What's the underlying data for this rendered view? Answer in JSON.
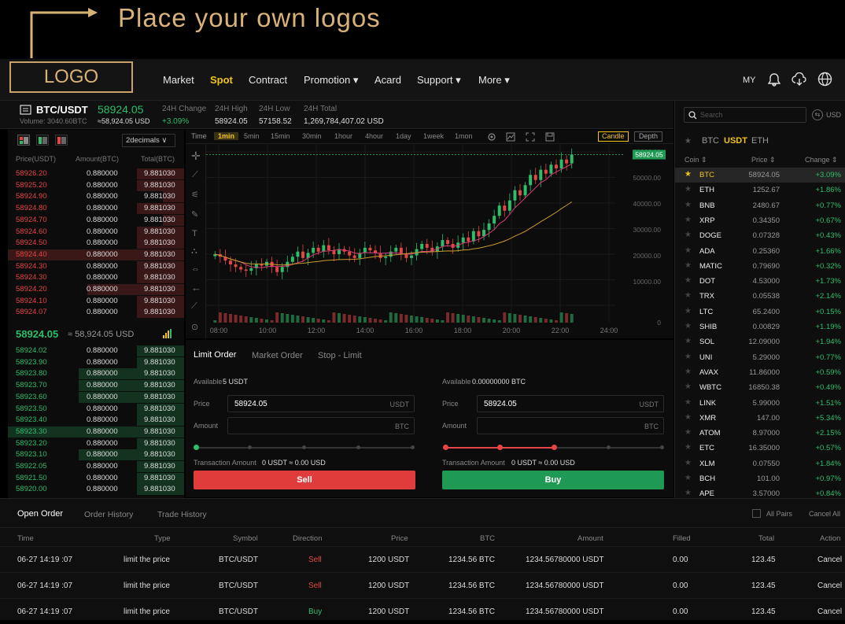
{
  "annotation": {
    "text": "Place your own logos"
  },
  "logo": {
    "text": "LOGO"
  },
  "nav": {
    "items": [
      "Market",
      "Spot",
      "Contract",
      "Promotion ▾",
      "Acard",
      "Support ▾",
      "More ▾"
    ],
    "lang": "MY"
  },
  "ticker": {
    "pair": "BTC/USDT",
    "price": "58924.05",
    "volume": "Volume: 3040.60BTC",
    "usd": "≈58,924.05 USD",
    "change_label": "24H Change",
    "change": "+3.09%",
    "high_label": "24H High",
    "high": "58924.05",
    "low_label": "24H Low",
    "low": "57158.52",
    "total_label": "24H Total",
    "total": "1,269,784,407.02 USD"
  },
  "book": {
    "decimals": "2decimals ∨",
    "headers": [
      "Price(USDT)",
      "Amount(BTC)",
      "Total(BTC)"
    ],
    "asks": [
      "58926.20",
      "58925.20",
      "58924.90",
      "58924.80",
      "58924.70",
      "58924.60",
      "58924.50",
      "58924.40",
      "58924.30",
      "58924.30",
      "58924.20",
      "58924.10",
      "58924.07"
    ],
    "bids": [
      "58924.02",
      "58923.90",
      "58923.80",
      "58923.70",
      "58923.60",
      "58923.50",
      "58923.40",
      "58923.30",
      "58923.20",
      "58923.10",
      "58922.05",
      "58921.50",
      "58920.00"
    ],
    "amount": "0.880000",
    "total": "9.881030",
    "last_price": "58924.05",
    "last_usd": "≈ 58,924.05 USD"
  },
  "chart_toolbar": {
    "intervals": [
      "Time",
      "1min",
      "5min",
      "15min",
      "30min",
      "1hour",
      "4hour",
      "1day",
      "1week",
      "1mon"
    ],
    "candle": "Candle",
    "depth": "Depth"
  },
  "chart_data": {
    "type": "candlestick",
    "x_ticks": [
      "08:00",
      "10:00",
      "12:00",
      "14:00",
      "16:00",
      "18:00",
      "20:00",
      "22:00",
      "24:00"
    ],
    "y_ticks": [
      "60000.00",
      "50000.00",
      "40000.00",
      "30000.00",
      "20000.00",
      "10000.00",
      "0"
    ],
    "ylim": [
      0,
      60000
    ],
    "last_price": "58924.05",
    "closes": [
      20000,
      19000,
      17500,
      16000,
      15000,
      14000,
      13500,
      14500,
      16000,
      15500,
      17000,
      15000,
      13000,
      15000,
      17000,
      19000,
      21000,
      18500,
      20500,
      22500,
      21000,
      23500,
      21500,
      20000,
      22000,
      21000,
      19500,
      18500,
      20500,
      22500,
      21500,
      20500,
      18500,
      19000,
      21000,
      22500,
      20000,
      18500,
      19500,
      22000,
      24000,
      22500,
      21000,
      23000,
      25500,
      24000,
      22500,
      24500,
      26500,
      25000,
      29000,
      27000,
      29500,
      32000,
      35000,
      39000,
      37000,
      41000,
      45000,
      43000,
      47000,
      51000,
      49000,
      53000,
      51500,
      55000,
      53500,
      57000,
      55500,
      58924
    ]
  },
  "order_tabs": [
    "Limit Order",
    "Market Order",
    "Stop - Limit"
  ],
  "order_form": {
    "buy_available_label": "Available",
    "buy_available": "5 USDT",
    "sell_available_label": "Available",
    "sell_available": "0.00000000 BTC",
    "price_label": "Price",
    "price_value": "58924.05",
    "price_unit": "USDT",
    "amount_label": "Amount",
    "amount_unit": "BTC",
    "tx_label": "Transaction Amount",
    "tx_value": "0 USDT ≈ 0.00 USD",
    "sell": "Sell",
    "buy": "Buy"
  },
  "market": {
    "search_placeholder": "Search",
    "usd": "USD",
    "tabs": [
      "BTC",
      "USDT",
      "ETH"
    ],
    "headers": [
      "Coin",
      "Price",
      "Change"
    ],
    "rows": [
      {
        "coin": "BTC",
        "price": "58924.05",
        "change": "+3.09%"
      },
      {
        "coin": "ETH",
        "price": "1252.67",
        "change": "+1.86%"
      },
      {
        "coin": "BNB",
        "price": "2480.67",
        "change": "+0.77%"
      },
      {
        "coin": "XRP",
        "price": "0.34350",
        "change": "+0.67%"
      },
      {
        "coin": "DOGE",
        "price": "0.07328",
        "change": "+0.43%"
      },
      {
        "coin": "ADA",
        "price": "0.25360",
        "change": "+1.66%"
      },
      {
        "coin": "MATIC",
        "price": "0.79690",
        "change": "+0.32%"
      },
      {
        "coin": "DOT",
        "price": "4.53000",
        "change": "+1.73%"
      },
      {
        "coin": "TRX",
        "price": "0.05538",
        "change": "+2.14%"
      },
      {
        "coin": "LTC",
        "price": "65.2400",
        "change": "+0.15%"
      },
      {
        "coin": "SHIB",
        "price": "0.00829",
        "change": "+1.19%"
      },
      {
        "coin": "SOL",
        "price": "12.09000",
        "change": "+1.94%"
      },
      {
        "coin": "UNI",
        "price": "5.29000",
        "change": "+0.77%"
      },
      {
        "coin": "AVAX",
        "price": "11.86000",
        "change": "+0.59%"
      },
      {
        "coin": "WBTC",
        "price": "16850.38",
        "change": "+0.49%"
      },
      {
        "coin": "LINK",
        "price": "5.99000",
        "change": "+1.51%"
      },
      {
        "coin": "XMR",
        "price": "147.00",
        "change": "+5.34%"
      },
      {
        "coin": "ATOM",
        "price": "8.97000",
        "change": "+2.15%"
      },
      {
        "coin": "ETC",
        "price": "16.35000",
        "change": "+0.57%"
      },
      {
        "coin": "XLM",
        "price": "0.07550",
        "change": "+1.84%"
      },
      {
        "coin": "BCH",
        "price": "101.00",
        "change": "+0.97%"
      },
      {
        "coin": "APE",
        "price": "3.57000",
        "change": "+0.84%"
      }
    ]
  },
  "orders": {
    "tabs": [
      "Open Order",
      "Order History",
      "Trade History"
    ],
    "all_pairs": "All Pairs",
    "cancel_all": "Cancel All",
    "headers": [
      "Time",
      "Type",
      "Symbol",
      "Direction",
      "Price",
      "BTC",
      "Amount",
      "Filled",
      "Total",
      "Action"
    ],
    "rows": [
      {
        "time": "06-27 14:19 :07",
        "type": "limit the price",
        "symbol": "BTC/USDT",
        "direction": "Sell",
        "price": "1200 USDT",
        "btc": "1234.56 BTC",
        "amount": "1234.56780000 USDT",
        "filled": "0.00",
        "total": "123.45",
        "action": "Cancel"
      },
      {
        "time": "06-27 14:19 :07",
        "type": "limit the price",
        "symbol": "BTC/USDT",
        "direction": "Sell",
        "price": "1200 USDT",
        "btc": "1234.56 BTC",
        "amount": "1234.56780000 USDT",
        "filled": "0.00",
        "total": "123.45",
        "action": "Cancel"
      },
      {
        "time": "06-27 14:19 :07",
        "type": "limit the price",
        "symbol": "BTC/USDT",
        "direction": "Buy",
        "price": "1200 USDT",
        "btc": "1234.56 BTC",
        "amount": "1234.56780000 USDT",
        "filled": "0.00",
        "total": "123.45",
        "action": "Cancel"
      }
    ]
  },
  "colors": {
    "accent": "#f0c419",
    "up": "#2ebd6b",
    "down": "#e54545",
    "logo": "#d9b27a"
  }
}
